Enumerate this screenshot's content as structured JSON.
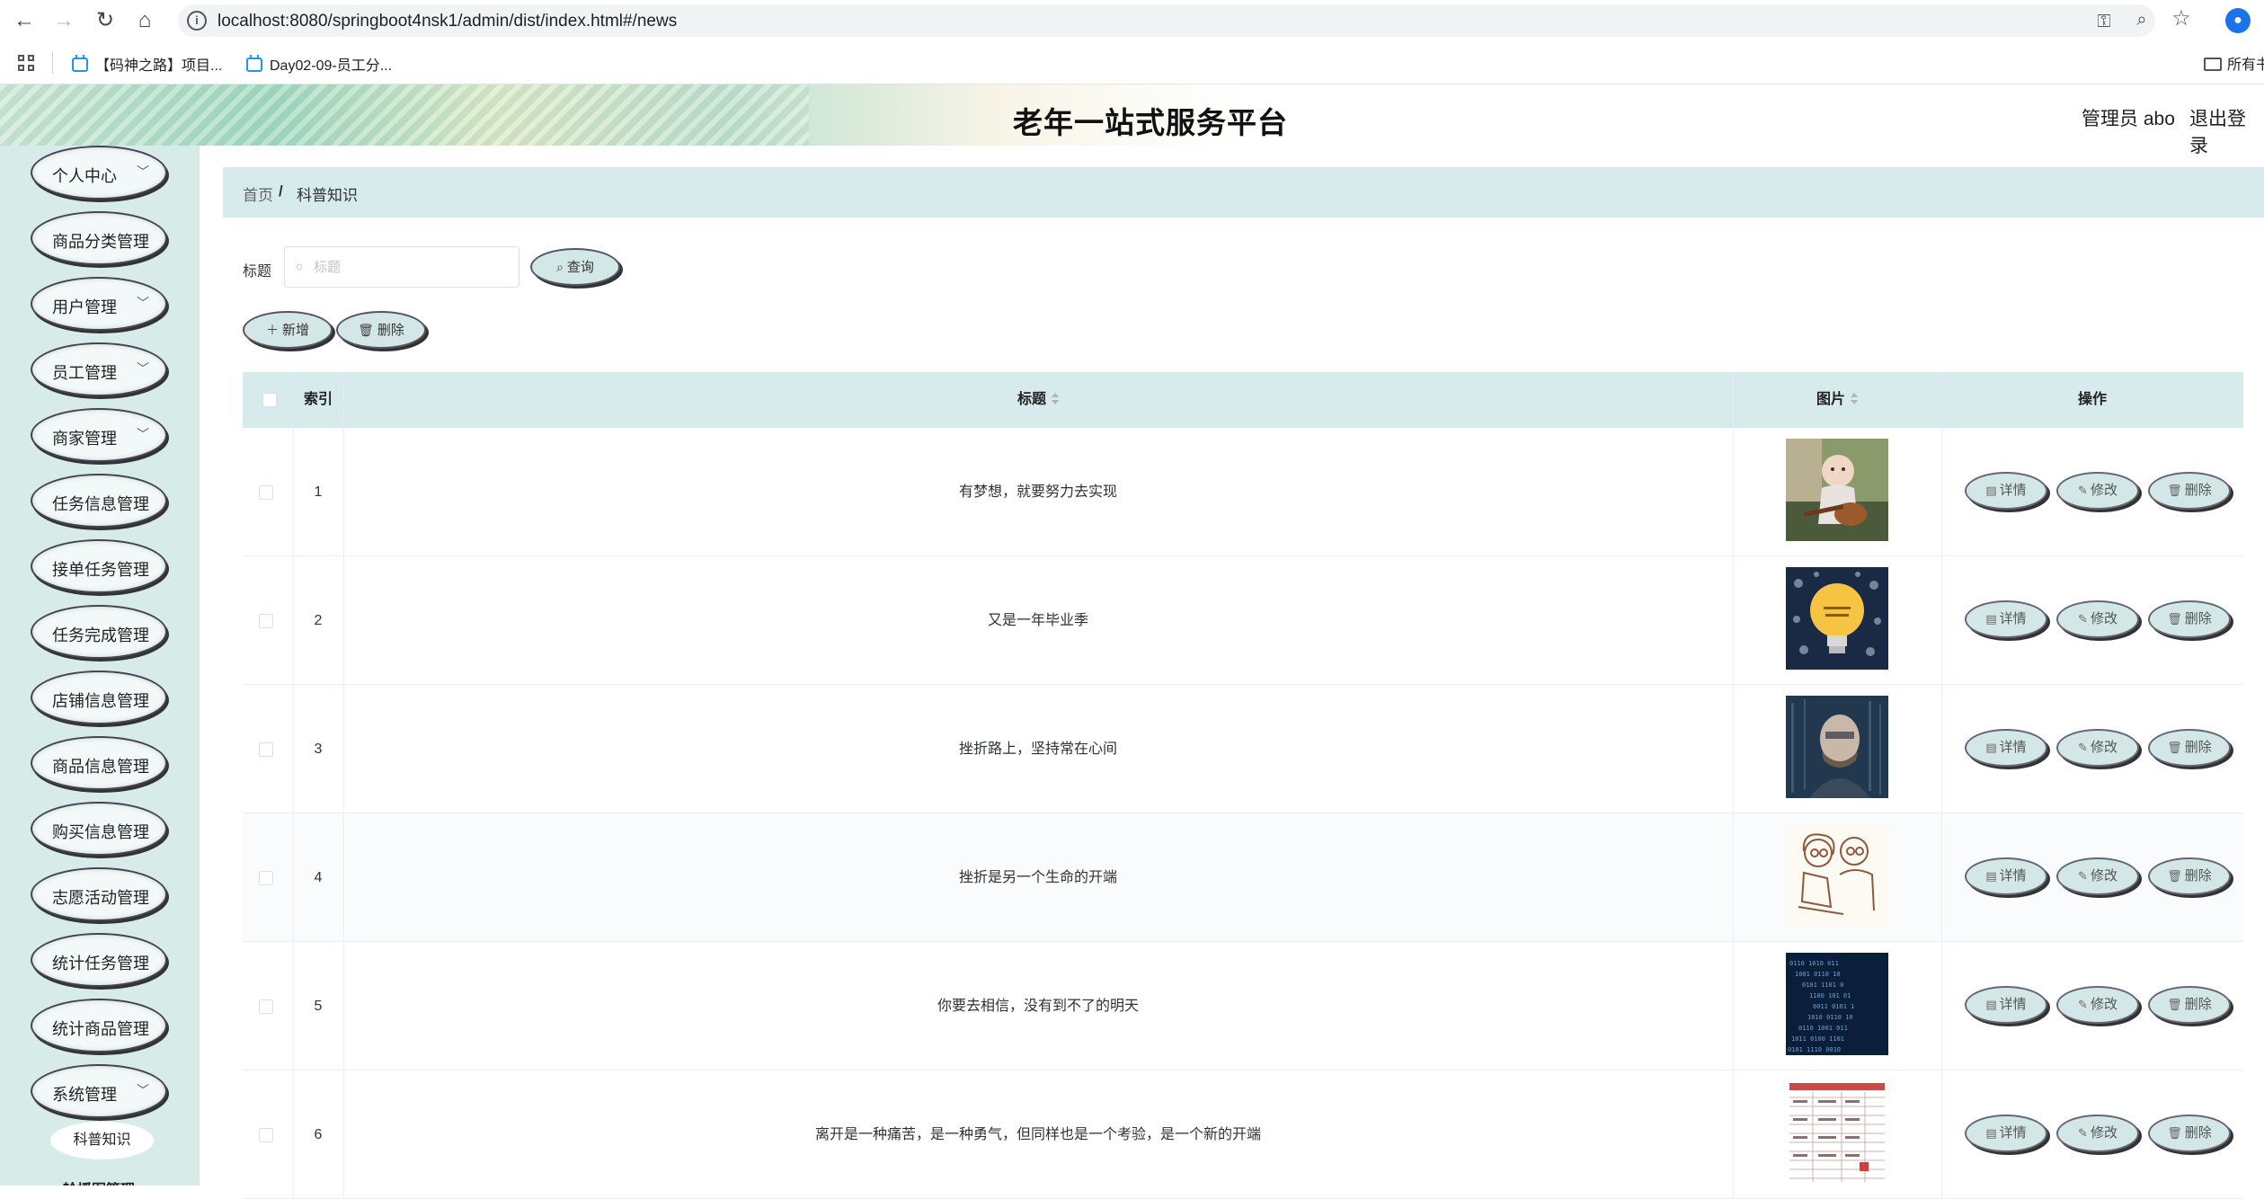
{
  "browser": {
    "url": "localhost:8080/springboot4nsk1/admin/dist/index.html#/news",
    "bookmarks": [
      "【码神之路】项目...",
      "Day02-09-员工分..."
    ],
    "bookmark_folder": "所有书"
  },
  "header": {
    "title": "老年一站式服务平台",
    "admin": "管理员 abo",
    "logout": "退出登录"
  },
  "sidebar": {
    "items": [
      {
        "label": "个人中心",
        "expandable": true
      },
      {
        "label": "商品分类管理",
        "expandable": false
      },
      {
        "label": "用户管理",
        "expandable": true
      },
      {
        "label": "员工管理",
        "expandable": true
      },
      {
        "label": "商家管理",
        "expandable": true
      },
      {
        "label": "任务信息管理",
        "expandable": false
      },
      {
        "label": "接单任务管理",
        "expandable": false
      },
      {
        "label": "任务完成管理",
        "expandable": false
      },
      {
        "label": "店铺信息管理",
        "expandable": false
      },
      {
        "label": "商品信息管理",
        "expandable": false
      },
      {
        "label": "购买信息管理",
        "expandable": false
      },
      {
        "label": "志愿活动管理",
        "expandable": false
      },
      {
        "label": "统计任务管理",
        "expandable": false
      },
      {
        "label": "统计商品管理",
        "expandable": false
      },
      {
        "label": "系统管理",
        "expandable": true
      }
    ],
    "active_sub": "科普知识",
    "cut_item": "轮播图管理"
  },
  "breadcrumb": {
    "home": "首页",
    "separator": "/",
    "current": "科普知识"
  },
  "search": {
    "label": "标题",
    "placeholder": "标题",
    "query_button": "查询"
  },
  "toolbar": {
    "add": "新增",
    "delete": "删除"
  },
  "table": {
    "columns": {
      "index": "索引",
      "title": "标题",
      "image": "图片",
      "actions": "操作"
    },
    "action_labels": {
      "detail": "详情",
      "edit": "修改",
      "delete": "删除"
    },
    "rows": [
      {
        "index": "1",
        "title": "有梦想，就要努力去实现",
        "image": "baby-with-guitar"
      },
      {
        "index": "2",
        "title": "又是一年毕业季",
        "image": "lightbulb-infographic"
      },
      {
        "index": "3",
        "title": "挫折路上，坚持常在心间",
        "image": "man-at-computer"
      },
      {
        "index": "4",
        "title": "挫折是另一个生命的开端",
        "image": "couple-sketch-laptop"
      },
      {
        "index": "5",
        "title": "你要去相信，没有到不了的明天",
        "image": "binary-code-tunnel"
      },
      {
        "index": "6",
        "title": "离开是一种痛苦，是一种勇气，但同样也是一个考验，是一个新的开端",
        "image": "data-sheet"
      }
    ]
  },
  "colors": {
    "sidebar_bg": "#d7ece9",
    "table_header_bg": "#d7eaec",
    "button_bg": "#d3e8e6"
  }
}
